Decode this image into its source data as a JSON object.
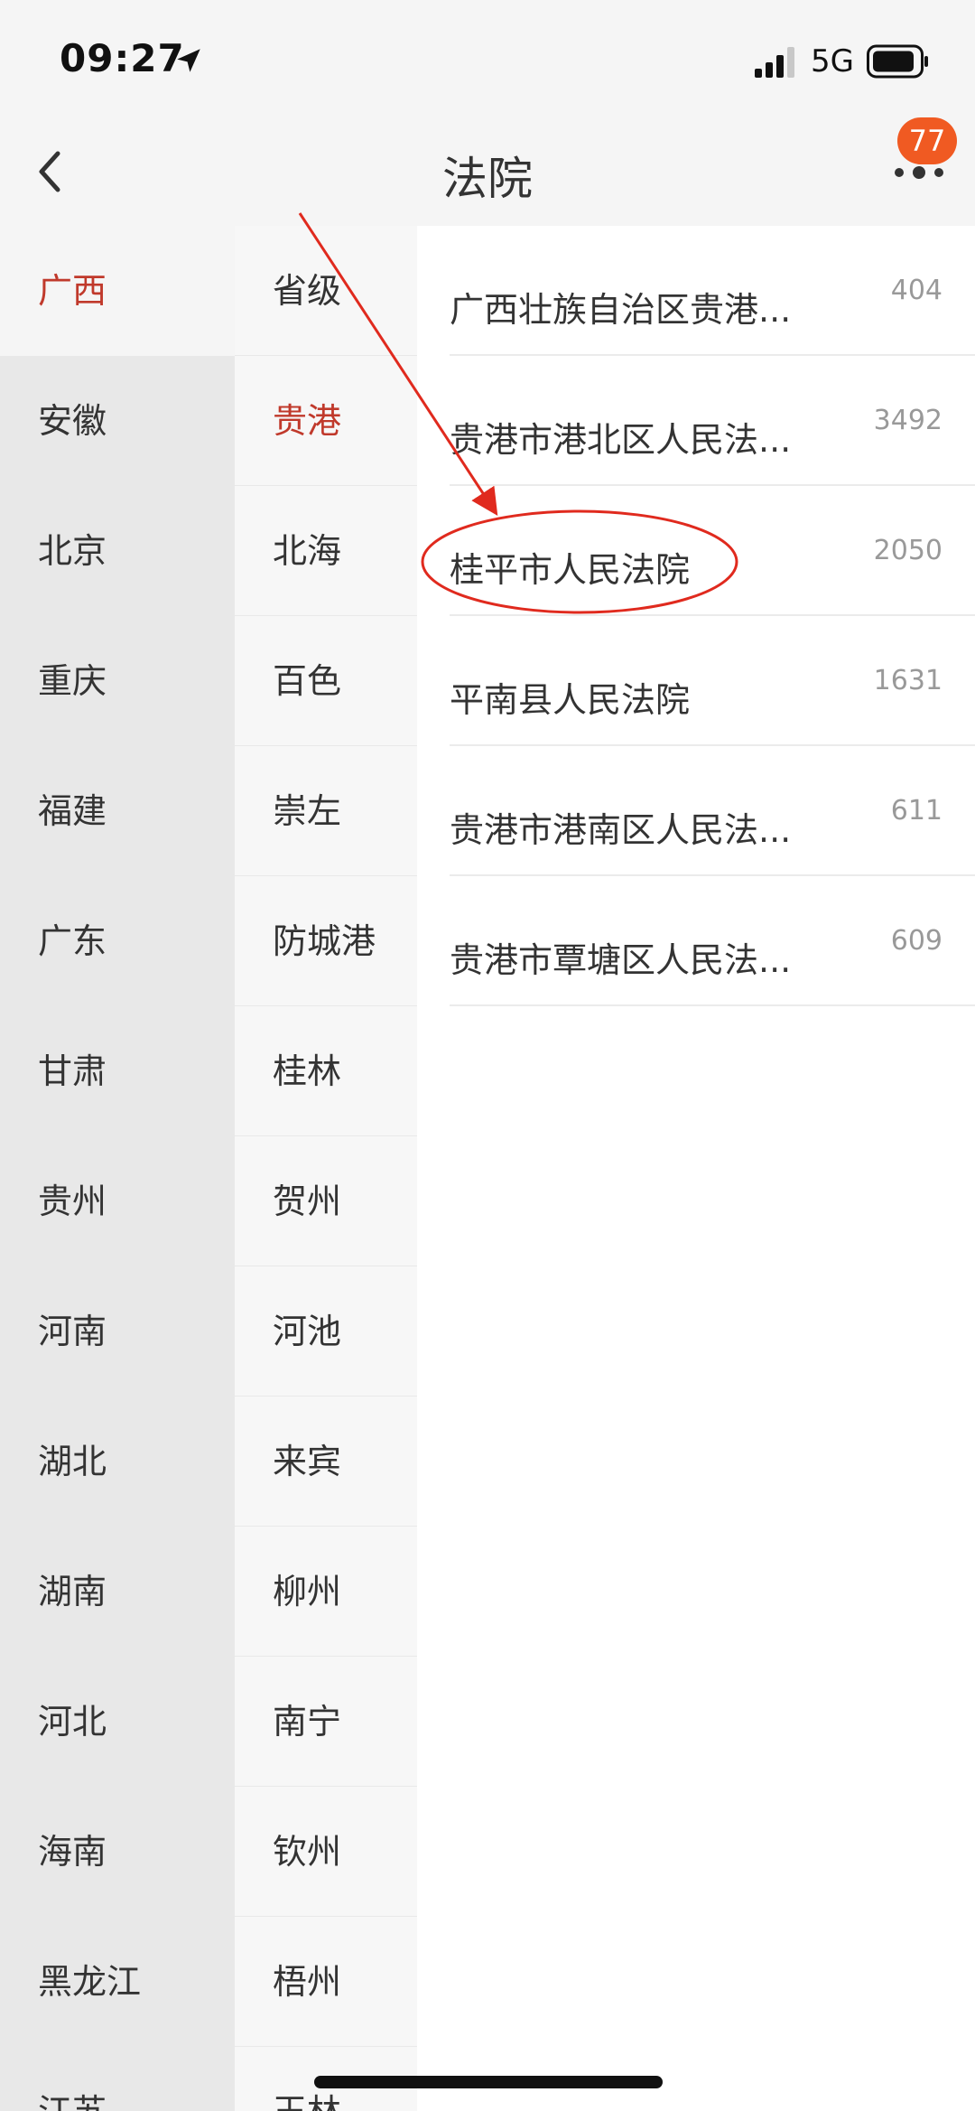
{
  "status_bar": {
    "time": "09:27",
    "network": "5G",
    "icons": [
      "location-arrow-icon",
      "signal-icon",
      "battery-icon"
    ]
  },
  "nav": {
    "title": "法院",
    "badge_count": "77",
    "back_icon": "back-chevron-icon",
    "more_icon": "more-dots-icon"
  },
  "provinces": [
    {
      "label": "广西",
      "active": true
    },
    {
      "label": "安徽"
    },
    {
      "label": "北京"
    },
    {
      "label": "重庆"
    },
    {
      "label": "福建"
    },
    {
      "label": "广东"
    },
    {
      "label": "甘肃"
    },
    {
      "label": "贵州"
    },
    {
      "label": "河南"
    },
    {
      "label": "湖北"
    },
    {
      "label": "湖南"
    },
    {
      "label": "河北"
    },
    {
      "label": "海南"
    },
    {
      "label": "黑龙江"
    },
    {
      "label": "江苏"
    }
  ],
  "cities": [
    {
      "label": "省级"
    },
    {
      "label": "贵港",
      "active": true
    },
    {
      "label": "北海"
    },
    {
      "label": "百色"
    },
    {
      "label": "崇左"
    },
    {
      "label": "防城港"
    },
    {
      "label": "桂林"
    },
    {
      "label": "贺州"
    },
    {
      "label": "河池"
    },
    {
      "label": "来宾"
    },
    {
      "label": "柳州"
    },
    {
      "label": "南宁"
    },
    {
      "label": "钦州"
    },
    {
      "label": "梧州"
    },
    {
      "label": "玉林"
    }
  ],
  "courts": [
    {
      "name": "广西壮族自治区贵港...",
      "count": "404"
    },
    {
      "name": "贵港市港北区人民法...",
      "count": "3492"
    },
    {
      "name": "桂平市人民法院",
      "count": "2050",
      "highlighted": true
    },
    {
      "name": "平南县人民法院",
      "count": "1631"
    },
    {
      "name": "贵港市港南区人民法...",
      "count": "611"
    },
    {
      "name": "贵港市覃塘区人民法...",
      "count": "609"
    }
  ],
  "colors": {
    "accent_red": "#c0392b",
    "badge_orange": "#f05a22",
    "annotation_red": "#e02a1e"
  }
}
